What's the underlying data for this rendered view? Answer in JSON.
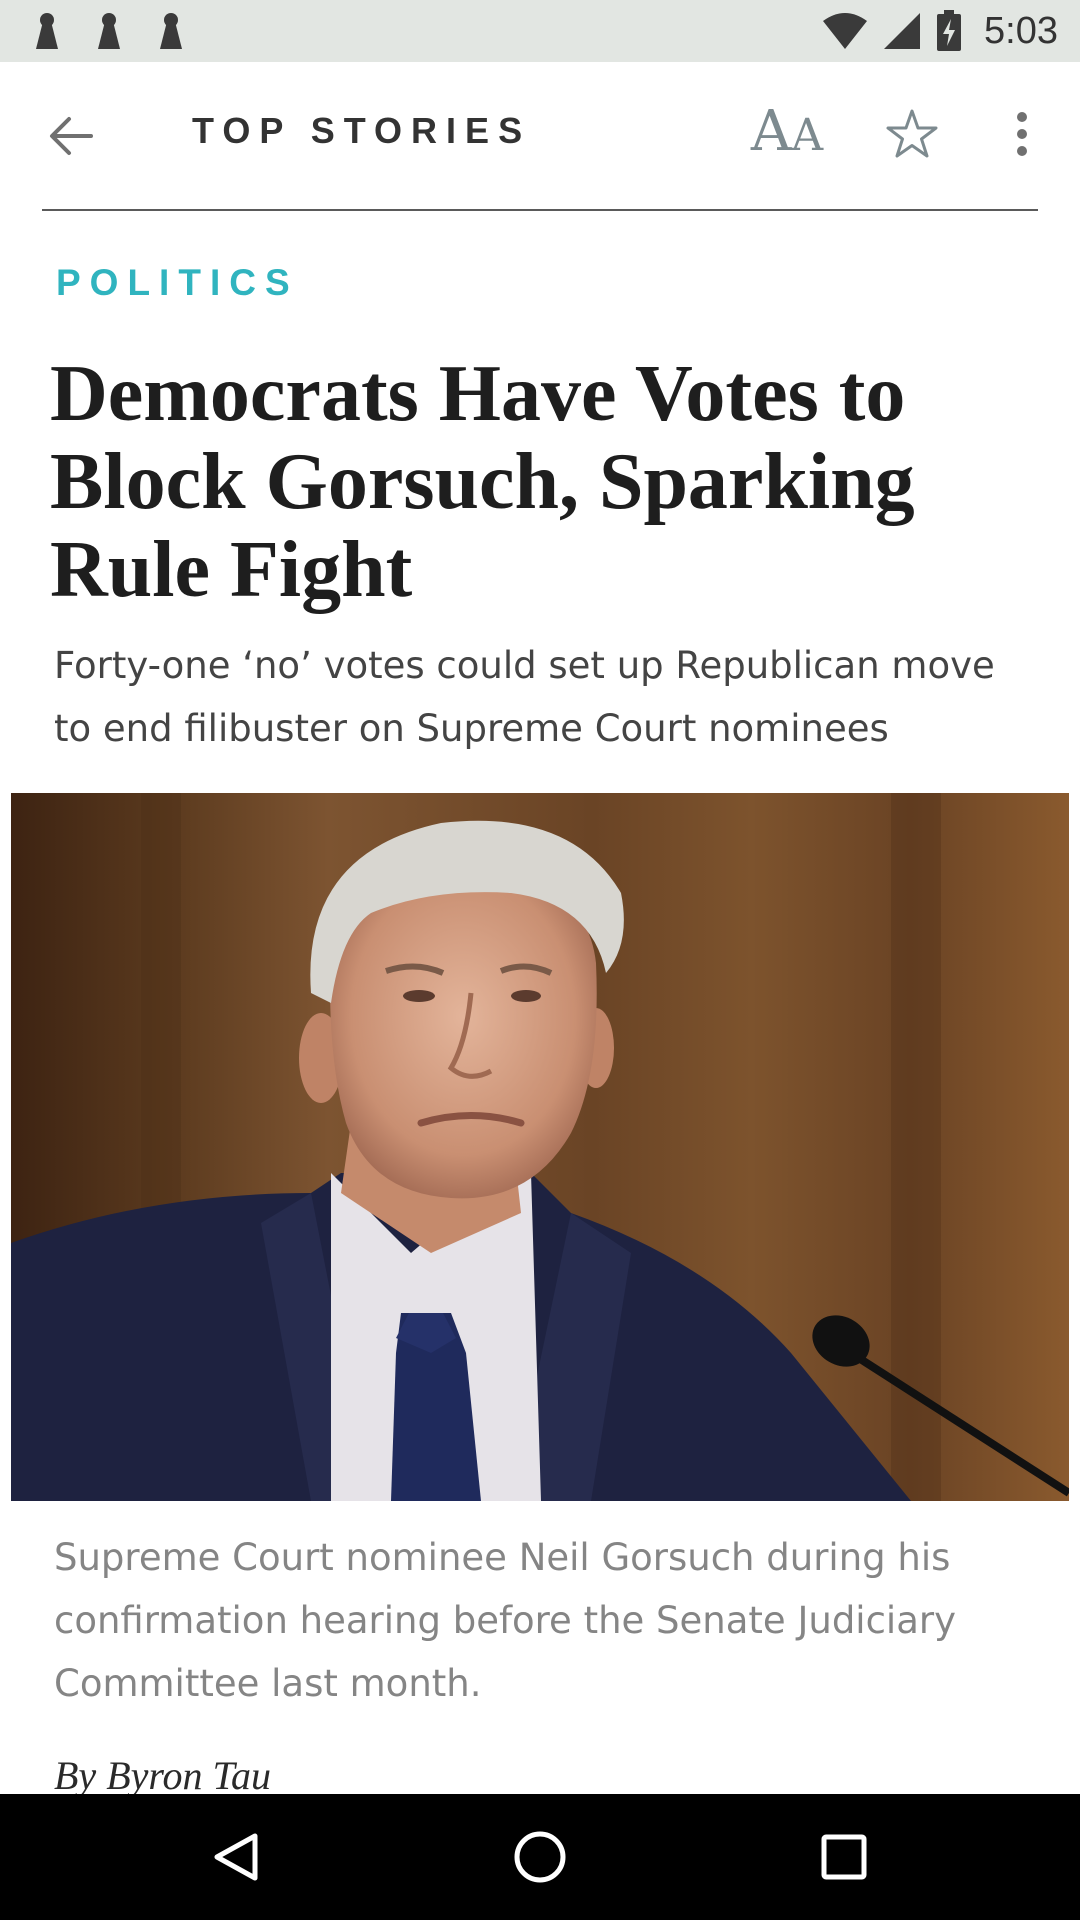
{
  "status_bar": {
    "notification_icons": [
      "keyhole-icon",
      "keyhole-icon",
      "keyhole-icon"
    ],
    "icons": [
      "wifi-icon",
      "cell-signal-icon",
      "battery-charging-icon"
    ],
    "time": "5:03"
  },
  "app_bar": {
    "title": "TOP STORIES",
    "text_size_label_big": "A",
    "text_size_label_small": "A",
    "icons": [
      "back-arrow-icon",
      "text-size-icon",
      "star-icon",
      "more-vert-icon"
    ]
  },
  "article": {
    "section": "POLITICS",
    "headline": "Democrats Have Votes to Block Gorsuch, Sparking Rule Fight",
    "dek": "Forty-one ‘no’ votes could set up Republican move to end filibuster on Supreme Court nominees",
    "caption": "Supreme Court nominee Neil Gorsuch during his confirmation hearing before the Senate Judiciary Committee last month.",
    "byline": "By Byron Tau"
  },
  "nav_bar": {
    "icons": [
      "back-triangle-icon",
      "home-circle-icon",
      "recents-square-icon"
    ]
  },
  "colors": {
    "accent": "#30b4bf",
    "status_bar_bg": "#e2e6e2",
    "nav_bar_bg": "#000000"
  }
}
